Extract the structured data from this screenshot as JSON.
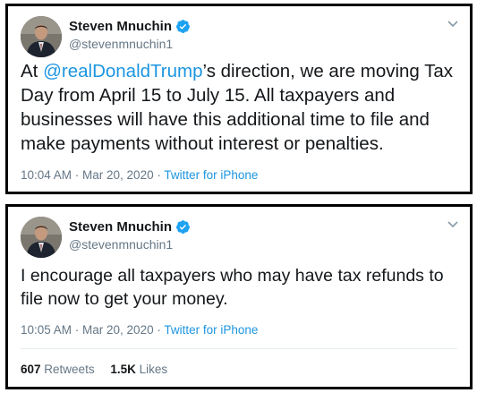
{
  "tweets": [
    {
      "author": {
        "name": "Steven Mnuchin",
        "handle": "@stevenmnuchin1"
      },
      "text_mention": "@realDonaldTrump",
      "text_rest": "’s direction, we are moving Tax Day from April 15 to July 15. All taxpayers and businesses will have this additional time to file and make payments without interest or penalties.",
      "text_prefix": "At ",
      "timestamp": "10:04 AM · Mar 20, 2020 · ",
      "source": "Twitter for iPhone"
    },
    {
      "author": {
        "name": "Steven Mnuchin",
        "handle": "@stevenmnuchin1"
      },
      "text": "I encourage all taxpayers who may have tax refunds to file now to get your money.",
      "timestamp": "10:05 AM · Mar 20, 2020 · ",
      "source": "Twitter for iPhone",
      "stats": {
        "retweets_count": "607",
        "retweets_label": "Retweets",
        "likes_count": "1.5K",
        "likes_label": "Likes"
      }
    }
  ],
  "icons": {
    "verified": "verified-badge-icon",
    "menu": "chevron-down-icon"
  },
  "colors": {
    "link": "#1b95e0",
    "secondary": "#657786",
    "verified": "#1da1f2"
  }
}
